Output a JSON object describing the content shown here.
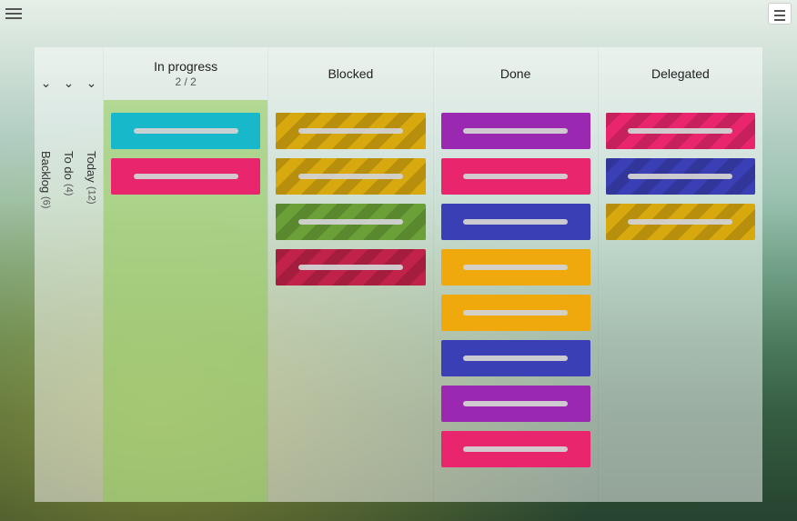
{
  "swimlanes": [
    {
      "label": "Backlog",
      "count": "(6)"
    },
    {
      "label": "To do",
      "count": "(4)"
    },
    {
      "label": "Today",
      "count": "(12)"
    }
  ],
  "columns": {
    "in_progress": {
      "label": "In progress",
      "sub": "2 / 2"
    },
    "blocked": {
      "label": "Blocked"
    },
    "done": {
      "label": "Done"
    },
    "delegated": {
      "label": "Delegated"
    }
  },
  "cards": {
    "in_progress": [
      {
        "color": "cyan",
        "hatched": false
      },
      {
        "color": "pink",
        "hatched": false
      }
    ],
    "blocked": [
      {
        "color": "gold",
        "hatched": true
      },
      {
        "color": "gold",
        "hatched": true
      },
      {
        "color": "green",
        "hatched": true
      },
      {
        "color": "red",
        "hatched": true
      }
    ],
    "done": [
      {
        "color": "purple",
        "hatched": false
      },
      {
        "color": "pink",
        "hatched": false
      },
      {
        "color": "blue",
        "hatched": false
      },
      {
        "color": "amber",
        "hatched": false
      },
      {
        "color": "amber",
        "hatched": false
      },
      {
        "color": "blue",
        "hatched": false
      },
      {
        "color": "purple",
        "hatched": false
      },
      {
        "color": "pink",
        "hatched": false
      }
    ],
    "delegated": [
      {
        "color": "pink",
        "hatched": true
      },
      {
        "color": "blue",
        "hatched": true
      },
      {
        "color": "gold",
        "hatched": true
      }
    ]
  }
}
